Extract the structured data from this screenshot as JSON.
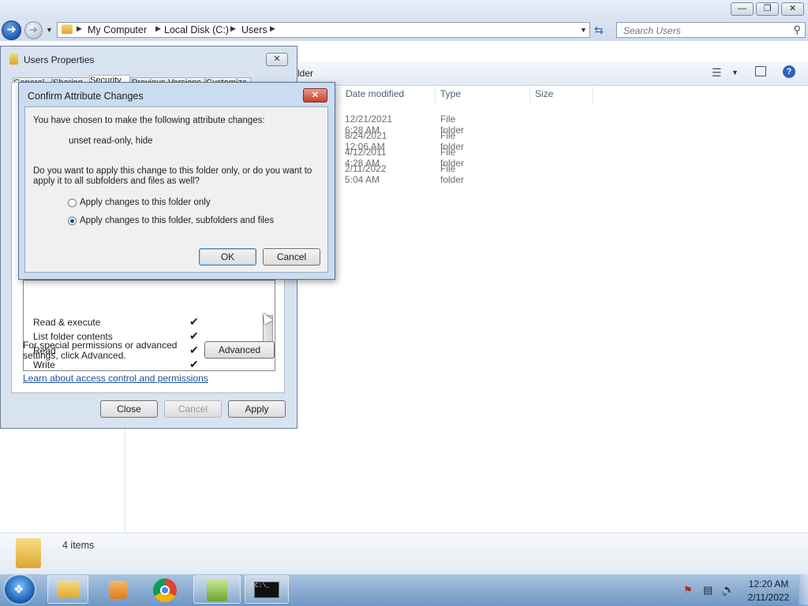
{
  "explorer": {
    "address": {
      "crumbs": [
        "My Computer",
        "Local Disk (C:)",
        "Users"
      ]
    },
    "search_placeholder": "Search Users",
    "toolbar": {
      "partial_label": "lder"
    },
    "columns": [
      "Date modified",
      "Type",
      "Size"
    ],
    "rows": [
      {
        "date": "12/21/2021 6:28 AM",
        "type": "File folder"
      },
      {
        "date": "8/24/2021 12:06 AM",
        "type": "File folder"
      },
      {
        "date": "4/12/2011 4:28 AM",
        "type": "File folder"
      },
      {
        "date": "2/11/2022 5:04 AM",
        "type": "File folder"
      }
    ],
    "details": {
      "count": "4 items"
    }
  },
  "properties": {
    "title": "Users Properties",
    "tabs": [
      "General",
      "Sharing",
      "Security",
      "Previous Versions",
      "Customize"
    ],
    "permissions": [
      "Read & execute",
      "List folder contents",
      "Read",
      "Write"
    ],
    "special_text": "For special permissions or advanced settings, click Advanced.",
    "advanced_label": "Advanced",
    "learn_link": "Learn about access control and permissions",
    "buttons": {
      "close": "Close",
      "cancel": "Cancel",
      "apply": "Apply"
    }
  },
  "confirm": {
    "title": "Confirm Attribute Changes",
    "intro": "You have chosen to make the following attribute changes:",
    "changes": "unset read-only, hide",
    "question": "Do you want to apply this change to this folder only, or do you want to apply it to all subfolders and files as well?",
    "option_folder_only": "Apply changes to this folder only",
    "option_all": "Apply changes to this folder, subfolders and files",
    "selected": "option_all",
    "ok": "OK",
    "cancel": "Cancel"
  },
  "taskbar": {
    "clock_time": "12:20 AM",
    "clock_date": "2/11/2022"
  },
  "colors": {
    "accent": "#1f5bb5",
    "link": "#1a4f9c",
    "close_red": "#c6412b"
  }
}
